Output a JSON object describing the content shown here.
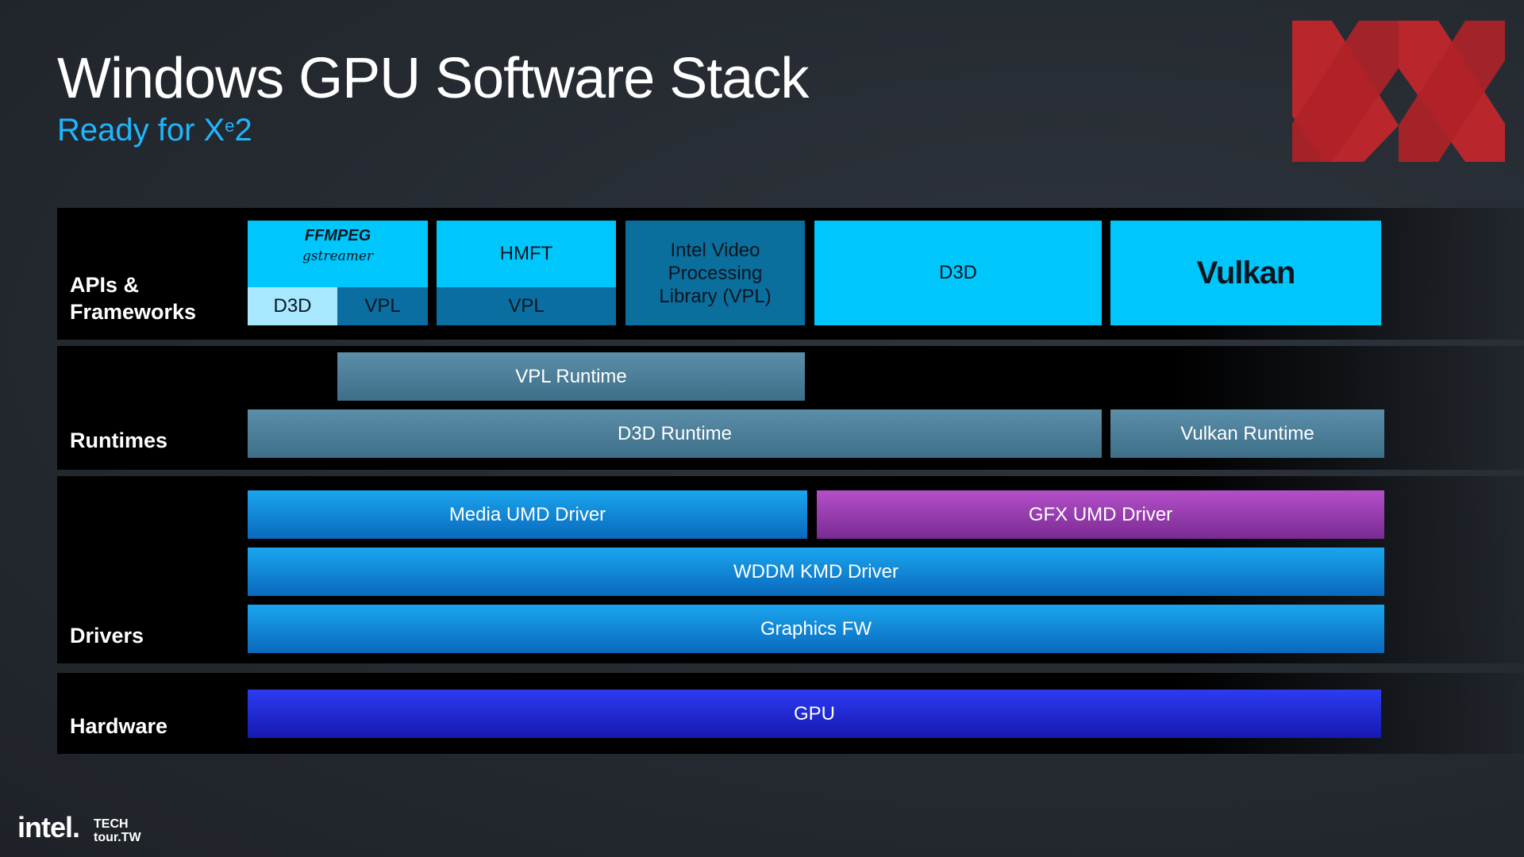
{
  "header": {
    "title": "Windows GPU Software Stack",
    "subtitle_prefix": "Ready for X",
    "subtitle_sup": "e",
    "subtitle_suffix": "2"
  },
  "rows": {
    "apis_label": "APIs & Frameworks",
    "runtimes_label": "Runtimes",
    "drivers_label": "Drivers",
    "hardware_label": "Hardware"
  },
  "apis": {
    "ffmpeg_logo_text": "FFMPEG",
    "gstreamer_logo_text": "gstreamer",
    "ffmpeg_d3d": "D3D",
    "ffmpeg_vpl": "VPL",
    "hmft": "HMFT",
    "hmft_vpl": "VPL",
    "intel_vpl": "Intel Video Processing Library (VPL)",
    "d3d": "D3D",
    "vulkan_logo_text": "Vulkan"
  },
  "runtimes": {
    "vpl_runtime": "VPL Runtime",
    "d3d_runtime": "D3D Runtime",
    "vulkan_runtime": "Vulkan Runtime"
  },
  "drivers": {
    "media_umd": "Media UMD Driver",
    "gfx_umd": "GFX UMD Driver",
    "wddm_kmd": "WDDM KMD Driver",
    "graphics_fw": "Graphics FW"
  },
  "hardware": {
    "gpu": "GPU"
  },
  "footer": {
    "intel": "intel.",
    "tech": "TECH",
    "tour": "tour.TW"
  },
  "colors": {
    "accent_cyan": "#00c7fb",
    "subtitle_blue": "#1fb6ff",
    "gfx_purple": "#9b3db3",
    "gpu_blue": "#1f28d8",
    "logo_red": "#c1272d"
  }
}
